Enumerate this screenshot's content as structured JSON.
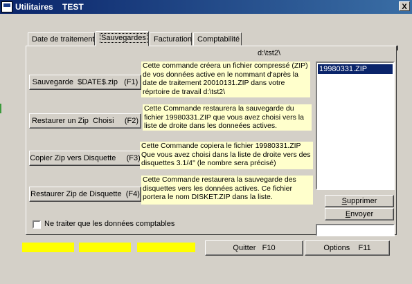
{
  "window": {
    "title": "Utilitaires    TEST",
    "close_label": "X"
  },
  "tabs": [
    {
      "label": "Date de traitement"
    },
    {
      "label": "Sauvegardes"
    },
    {
      "label": "Facturation"
    },
    {
      "label": "Comptabilité"
    }
  ],
  "panel": {
    "path": "d:\\tst2\\",
    "actions": [
      {
        "button": "Sauvegarde  $DATE$.zip   (F1)",
        "description": "Cette commande créera un fichier compressé (ZIP) de vos données active en le nommant d'après la date de traitement 20010131.ZIP dans votre réprtoire de travail d:\\tst2\\"
      },
      {
        "button": "Restaurer un Zip  Choisi     (F2)",
        "description": "Cette Commande restaurera la sauvegarde  du fichier 19980331.ZIP  que vous avez choisi vers la liste de droite dans les donneées actives."
      },
      {
        "button": "Copier Zip vers Disquette     (F3)",
        "description": "Cette Commande copiera le fichier 19980331.ZIP Que vous avez choisi dans la liste de droite vers des disquettes 3.1/4\" (le nombre sera précisé)"
      },
      {
        "button": "Restaurer Zip de Disquette  (F4)",
        "description": "Cette Commande restaurera la sauvegarde des disquettes vers les données actives. Ce fichier portera le nom DISKET.ZIP dans la liste."
      }
    ],
    "file_list": [
      "19980331.ZIP"
    ],
    "delete_button": "Supprimer",
    "send_button": "Envoyer",
    "file_field_value": "",
    "checkbox_label": "Ne traiter que les données comptables",
    "checkbox_checked": false
  },
  "footer": {
    "quit_button": "Quitter   F10",
    "options_button": "Options    F11"
  },
  "colors": {
    "info_bg": "#ffffcc",
    "status_yellow": "#ffff00",
    "title_bar": "#0a246a"
  }
}
